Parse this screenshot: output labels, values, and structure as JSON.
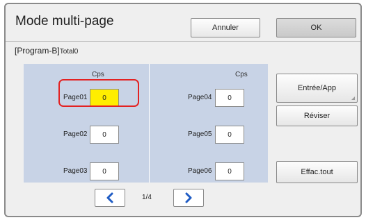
{
  "header": {
    "title": "Mode multi-page",
    "cancel_label": "Annuler",
    "ok_label": "OK"
  },
  "program": {
    "name": "[Program-B]",
    "total": "Total0"
  },
  "columns": {
    "left_header": "Cps",
    "right_header": "Cps"
  },
  "pages": [
    {
      "label": "Page01",
      "copies": "0",
      "selected": true
    },
    {
      "label": "Page02",
      "copies": "0",
      "selected": false
    },
    {
      "label": "Page03",
      "copies": "0",
      "selected": false
    },
    {
      "label": "Page04",
      "copies": "0",
      "selected": false
    },
    {
      "label": "Page05",
      "copies": "0",
      "selected": false
    },
    {
      "label": "Page06",
      "copies": "0",
      "selected": false
    }
  ],
  "side_buttons": {
    "entry_label": "Entrée/App",
    "revise_label": "Réviser",
    "clear_all_label": "Effac.tout"
  },
  "pagination": {
    "indicator": "1/4",
    "prev_icon": "chevron-left-icon",
    "next_icon": "chevron-right-icon"
  },
  "colors": {
    "panel_bg": "#c8d3e6",
    "selected_field": "#ffee00",
    "highlight_ring": "#e32222",
    "nav_arrow": "#1f5cc4"
  }
}
